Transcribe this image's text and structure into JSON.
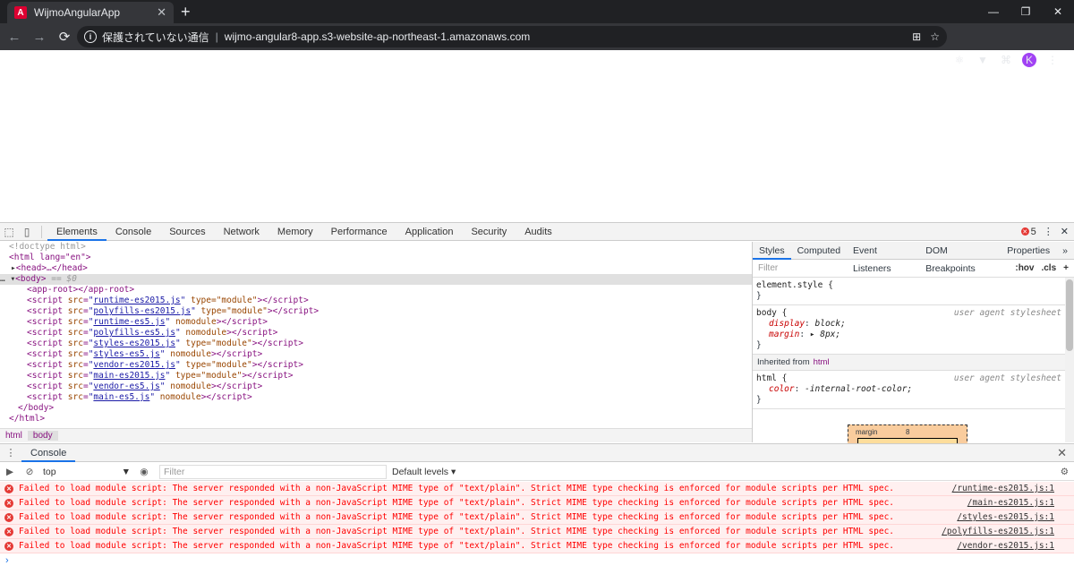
{
  "browser": {
    "tab_title": "WijmoAngularApp",
    "tab_close": "✕",
    "new_tab": "+",
    "window": {
      "minimize": "—",
      "maximize": "❐",
      "close": "✕"
    },
    "nav": {
      "back": "←",
      "forward": "→",
      "reload": "⟳"
    },
    "security_text": "保護されていない通信",
    "url": "wijmo-angular8-app.s3-website-ap-northeast-1.amazonaws.com",
    "avatar_letter": "K"
  },
  "devtools": {
    "tabs": [
      "Elements",
      "Console",
      "Sources",
      "Network",
      "Memory",
      "Performance",
      "Application",
      "Security",
      "Audits"
    ],
    "error_count": "5",
    "dom": {
      "doctype": "<!doctype html>",
      "html_open": "<html lang=\"en\">",
      "head": "<head>…</head>",
      "body_open": "<body>",
      "body_sel": "== $0",
      "app_root": "<app-root></app-root>",
      "scripts": [
        {
          "src": "runtime-es2015.js",
          "extra": " type=\"module\""
        },
        {
          "src": "polyfills-es2015.js",
          "extra": " type=\"module\""
        },
        {
          "src": "runtime-es5.js",
          "extra": " nomodule"
        },
        {
          "src": "polyfills-es5.js",
          "extra": " nomodule"
        },
        {
          "src": "styles-es2015.js",
          "extra": " type=\"module\""
        },
        {
          "src": "styles-es5.js",
          "extra": " nomodule"
        },
        {
          "src": "vendor-es2015.js",
          "extra": " type=\"module\""
        },
        {
          "src": "main-es2015.js",
          "extra": " type=\"module\""
        },
        {
          "src": "vendor-es5.js",
          "extra": " nomodule"
        },
        {
          "src": "main-es5.js",
          "extra": " nomodule"
        }
      ],
      "body_close": "</body>",
      "html_close": "</html>"
    },
    "breadcrumbs": [
      "html",
      "body"
    ],
    "styles": {
      "tabs": [
        "Styles",
        "Computed",
        "Event Listeners",
        "DOM Breakpoints",
        "Properties"
      ],
      "more": "»",
      "filter_placeholder": "Filter",
      "hov": ":hov",
      "cls": ".cls",
      "add": "+",
      "element_style": "element.style {",
      "close_brace": "}",
      "body_rule": "body {",
      "ua": "user agent stylesheet",
      "body_props": [
        {
          "name": "display",
          "value": "block;"
        },
        {
          "name": "margin",
          "value": "▸ 8px;"
        }
      ],
      "inherited_label": "Inherited from",
      "inherited_tag": "html",
      "html_rule": "html {",
      "html_props": [
        {
          "name": "color",
          "value": "-internal-root-color;"
        }
      ],
      "box_label": "margin",
      "box_value": "8"
    },
    "console": {
      "tab": "Console",
      "context": "top",
      "filter_placeholder": "Filter",
      "levels": "Default levels ▾",
      "messages": [
        {
          "text": "Failed to load module script: The server responded with a non-JavaScript MIME type of \"text/plain\". Strict MIME type checking is enforced for module scripts per HTML spec.",
          "source": "/runtime-es2015.js:1"
        },
        {
          "text": "Failed to load module script: The server responded with a non-JavaScript MIME type of \"text/plain\". Strict MIME type checking is enforced for module scripts per HTML spec.",
          "source": "/main-es2015.js:1"
        },
        {
          "text": "Failed to load module script: The server responded with a non-JavaScript MIME type of \"text/plain\". Strict MIME type checking is enforced for module scripts per HTML spec.",
          "source": "/styles-es2015.js:1"
        },
        {
          "text": "Failed to load module script: The server responded with a non-JavaScript MIME type of \"text/plain\". Strict MIME type checking is enforced for module scripts per HTML spec.",
          "source": "/polyfills-es2015.js:1"
        },
        {
          "text": "Failed to load module script: The server responded with a non-JavaScript MIME type of \"text/plain\". Strict MIME type checking is enforced for module scripts per HTML spec.",
          "source": "/vendor-es2015.js:1"
        }
      ],
      "prompt": "›"
    }
  }
}
